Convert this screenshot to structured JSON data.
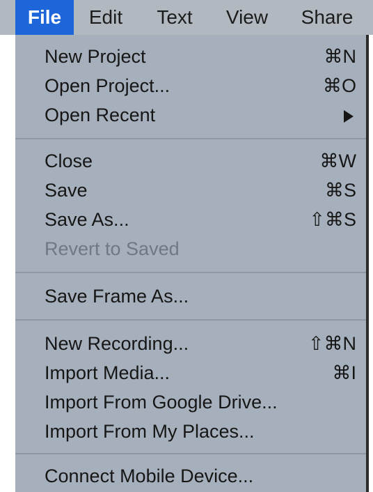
{
  "menubar": {
    "items": [
      {
        "label": "File"
      },
      {
        "label": "Edit"
      },
      {
        "label": "Text"
      },
      {
        "label": "View"
      },
      {
        "label": "Share"
      }
    ],
    "active": "File"
  },
  "file_menu": {
    "groups": [
      [
        {
          "label": "New Project",
          "shortcut": "⌘N"
        },
        {
          "label": "Open Project...",
          "shortcut": "⌘O"
        },
        {
          "label": "Open Recent",
          "shortcut": "",
          "submenu": true
        }
      ],
      [
        {
          "label": "Close",
          "shortcut": "⌘W"
        },
        {
          "label": "Save",
          "shortcut": "⌘S"
        },
        {
          "label": "Save As...",
          "shortcut": "⇧⌘S"
        },
        {
          "label": "Revert to Saved",
          "shortcut": "",
          "disabled": true
        }
      ],
      [
        {
          "label": "Save Frame As...",
          "shortcut": ""
        }
      ],
      [
        {
          "label": "New Recording...",
          "shortcut": "⇧⌘N"
        },
        {
          "label": "Import Media...",
          "shortcut": "⌘I"
        },
        {
          "label": "Import From Google Drive...",
          "shortcut": ""
        },
        {
          "label": "Import From My Places...",
          "shortcut": ""
        }
      ],
      [
        {
          "label": "Connect Mobile Device...",
          "shortcut": ""
        }
      ]
    ]
  },
  "colors": {
    "menubar_bg": "#b2b8c0",
    "active_highlight": "#1d66d9",
    "dropdown_bg": "#a6b0bc",
    "disabled_text": "#6f7884"
  },
  "icons": {
    "submenu": "submenu-arrow-icon"
  }
}
